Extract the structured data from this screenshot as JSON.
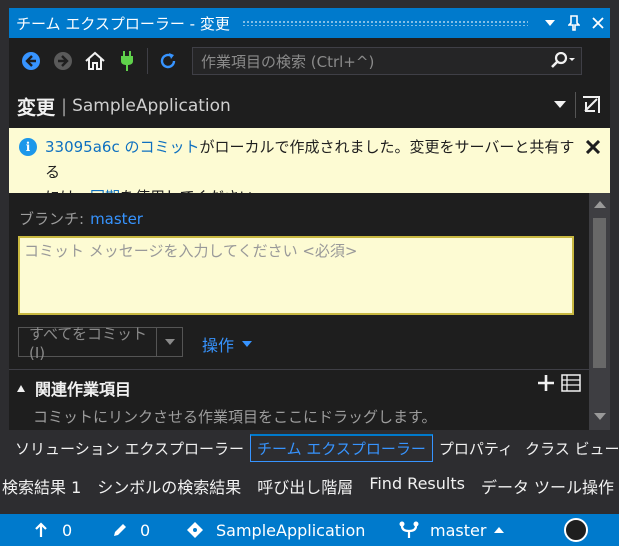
{
  "window": {
    "title": "チーム エクスプローラー - 変更",
    "pin_glyph": "▼",
    "close_glyph": "✕"
  },
  "toolbar": {
    "search_placeholder": "作業項目の検索 (Ctrl+^)"
  },
  "header": {
    "title": "変更",
    "separator": "|",
    "subtitle": "SampleApplication"
  },
  "notice": {
    "link_commit": "33095a6c のコミット",
    "text_1": "がローカルで作成されました。変更をサーバーと共有する",
    "text_2": "には、",
    "link_sync": "同期",
    "text_3": "を使用してください。"
  },
  "changes": {
    "branch_label": "ブランチ:",
    "branch_name": "master",
    "message_placeholder": "コミット メッセージを入力してください <必須>",
    "commit_button": "すべてをコミット(I)",
    "actions_label": "操作",
    "related_title": "関連作業項目",
    "related_desc": "コミットにリンクさせる作業項目をここにドラッグします。"
  },
  "tabs_upper": [
    "ソリューション エクスプローラー",
    "チーム エクスプローラー",
    "プロパティ",
    "クラス ビュー"
  ],
  "tabs_lower": [
    "検索結果 1",
    "シンボルの検索結果",
    "呼び出し階層",
    "Find Results",
    "データ ツール操作"
  ],
  "statusbar": {
    "up_count": "0",
    "edit_count": "0",
    "repo": "SampleApplication",
    "branch": "master"
  },
  "colors": {
    "accent": "#007acc",
    "link": "#3794ff",
    "notice_bg": "#fdfbd3"
  }
}
